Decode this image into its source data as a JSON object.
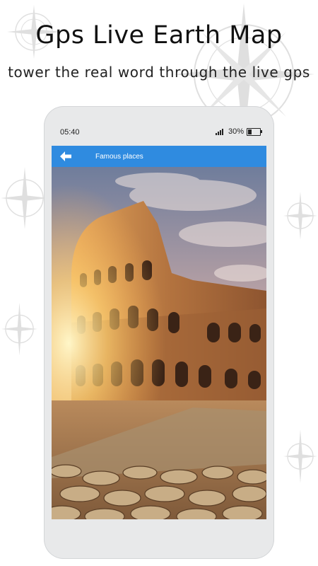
{
  "headline": "Gps Live Earth Map",
  "subheadline": "tower the real word through the live gps",
  "phone": {
    "status": {
      "time": "05:40",
      "battery_text": "30%",
      "battery_level": 0.3
    },
    "app_bar": {
      "back_icon": "arrow-left-icon",
      "title": "Famous places"
    },
    "photo": {
      "subject": "colosseum"
    }
  },
  "colors": {
    "app_bar": "#2f8be0",
    "phone_frame": "#e8e9ea",
    "background": "#ffffff"
  }
}
